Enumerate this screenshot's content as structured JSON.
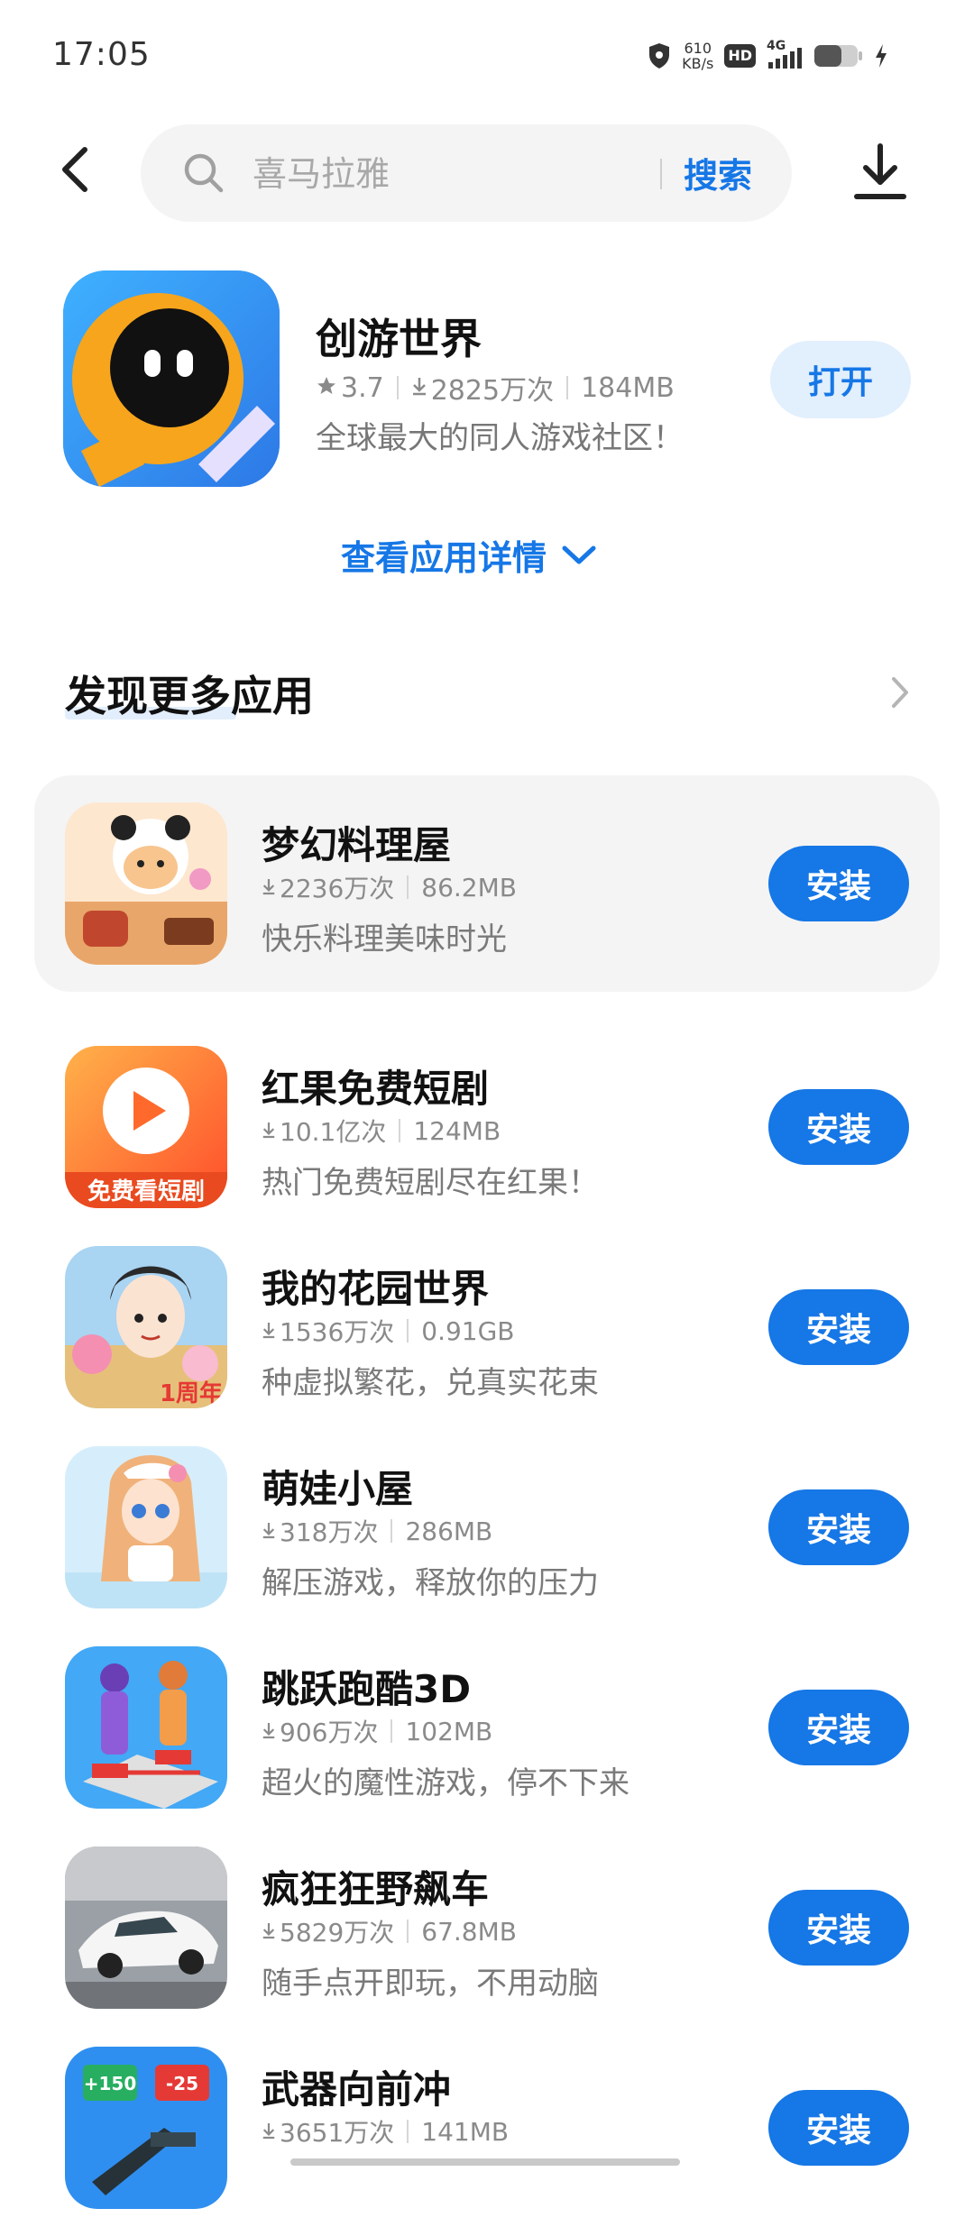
{
  "status_bar": {
    "time": "17:05",
    "net_speed_value": "610",
    "net_speed_unit": "KB/s",
    "hd_label": "HD",
    "signal_label": "4G"
  },
  "search": {
    "placeholder": "喜马拉雅",
    "button_label": "搜索"
  },
  "featured": {
    "name": "创游世界",
    "rating": "3.7",
    "downloads": "2825万次",
    "size": "184MB",
    "description": "全球最大的同人游戏社区！",
    "action_label": "打开"
  },
  "details_link": {
    "label": "查看应用详情"
  },
  "section": {
    "title": "发现更多应用"
  },
  "apps": [
    {
      "name": "梦幻料理屋",
      "downloads": "2236万次",
      "size": "86.2MB",
      "description": "快乐料理美味时光",
      "action": "安装",
      "accent": "#f2a65a"
    },
    {
      "name": "红果免费短剧",
      "downloads": "10.1亿次",
      "size": "124MB",
      "description": "热门免费短剧尽在红果！",
      "action": "安装",
      "accent": "#ff6a2c",
      "icon_badge": "免费看短剧"
    },
    {
      "name": "我的花园世界",
      "downloads": "1536万次",
      "size": "0.91GB",
      "description": "种虚拟繁花，兑真实花束",
      "action": "安装",
      "accent": "#7dbbe8",
      "icon_badge": "1周年"
    },
    {
      "name": "萌娃小屋",
      "downloads": "318万次",
      "size": "286MB",
      "description": "解压游戏，释放你的压力",
      "action": "安装",
      "accent": "#a7d6f2"
    },
    {
      "name": "跳跃跑酷3D",
      "downloads": "906万次",
      "size": "102MB",
      "description": "超火的魔性游戏，停不下来",
      "action": "安装",
      "accent": "#3aa3f2"
    },
    {
      "name": "疯狂狂野飙车",
      "downloads": "5829万次",
      "size": "67.8MB",
      "description": "随手点开即玩，不用动脑",
      "action": "安装",
      "accent": "#8a8a8a"
    },
    {
      "name": "武器向前冲",
      "downloads": "3651万次",
      "size": "141MB",
      "description": "",
      "action": "安装",
      "accent": "#2f8ff0",
      "icon_badge_left": "+150",
      "icon_badge_right": "-25"
    }
  ],
  "colors": {
    "accent_blue": "#1677e6",
    "open_button_bg": "#e2effd",
    "highlight_row_bg": "#f4f4f4"
  }
}
